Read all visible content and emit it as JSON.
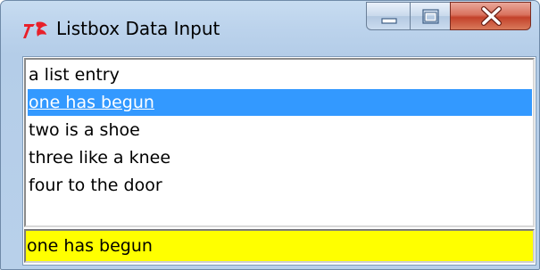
{
  "window": {
    "title": "Listbox Data Input",
    "icon": "tk-feather-icon"
  },
  "caption_buttons": {
    "minimize_icon": "minimize-icon",
    "maximize_icon": "maximize-icon",
    "close_icon": "close-icon"
  },
  "listbox": {
    "items": [
      "a list entry",
      "one has begun",
      "two is a shoe",
      "three like a knee",
      "four to the door"
    ],
    "selected_index": 1
  },
  "entry": {
    "value": "one has begun"
  },
  "colors": {
    "selection": "#3399ff",
    "entry_background": "#ffff00",
    "close_button": "#c3412a",
    "icon_red": "#e8202a"
  }
}
